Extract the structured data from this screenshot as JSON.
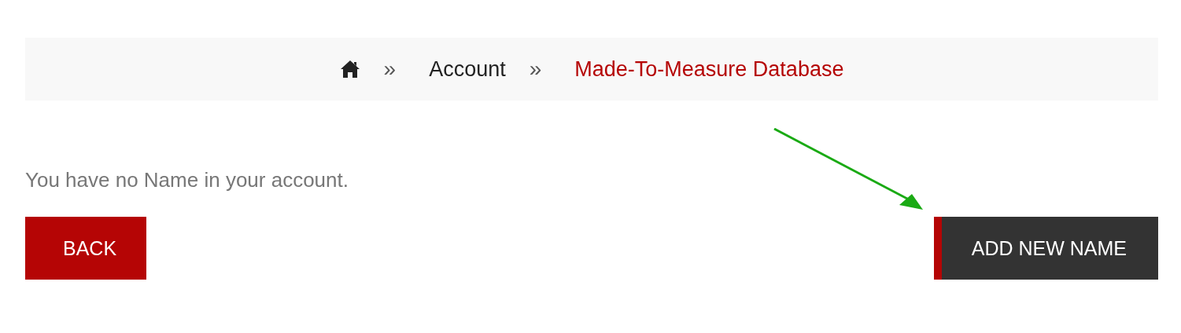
{
  "breadcrumb": [
    {
      "kind": "home"
    },
    {
      "kind": "separator",
      "label": "»"
    },
    {
      "kind": "link",
      "label": "Account"
    },
    {
      "kind": "separator",
      "label": "»"
    },
    {
      "kind": "current",
      "label": "Made-To-Measure Database"
    }
  ],
  "message": "You have no Name in your account.",
  "buttons": [
    {
      "kind": "back",
      "label": "BACK"
    },
    {
      "kind": "add",
      "label": "ADD NEW NAME"
    }
  ]
}
